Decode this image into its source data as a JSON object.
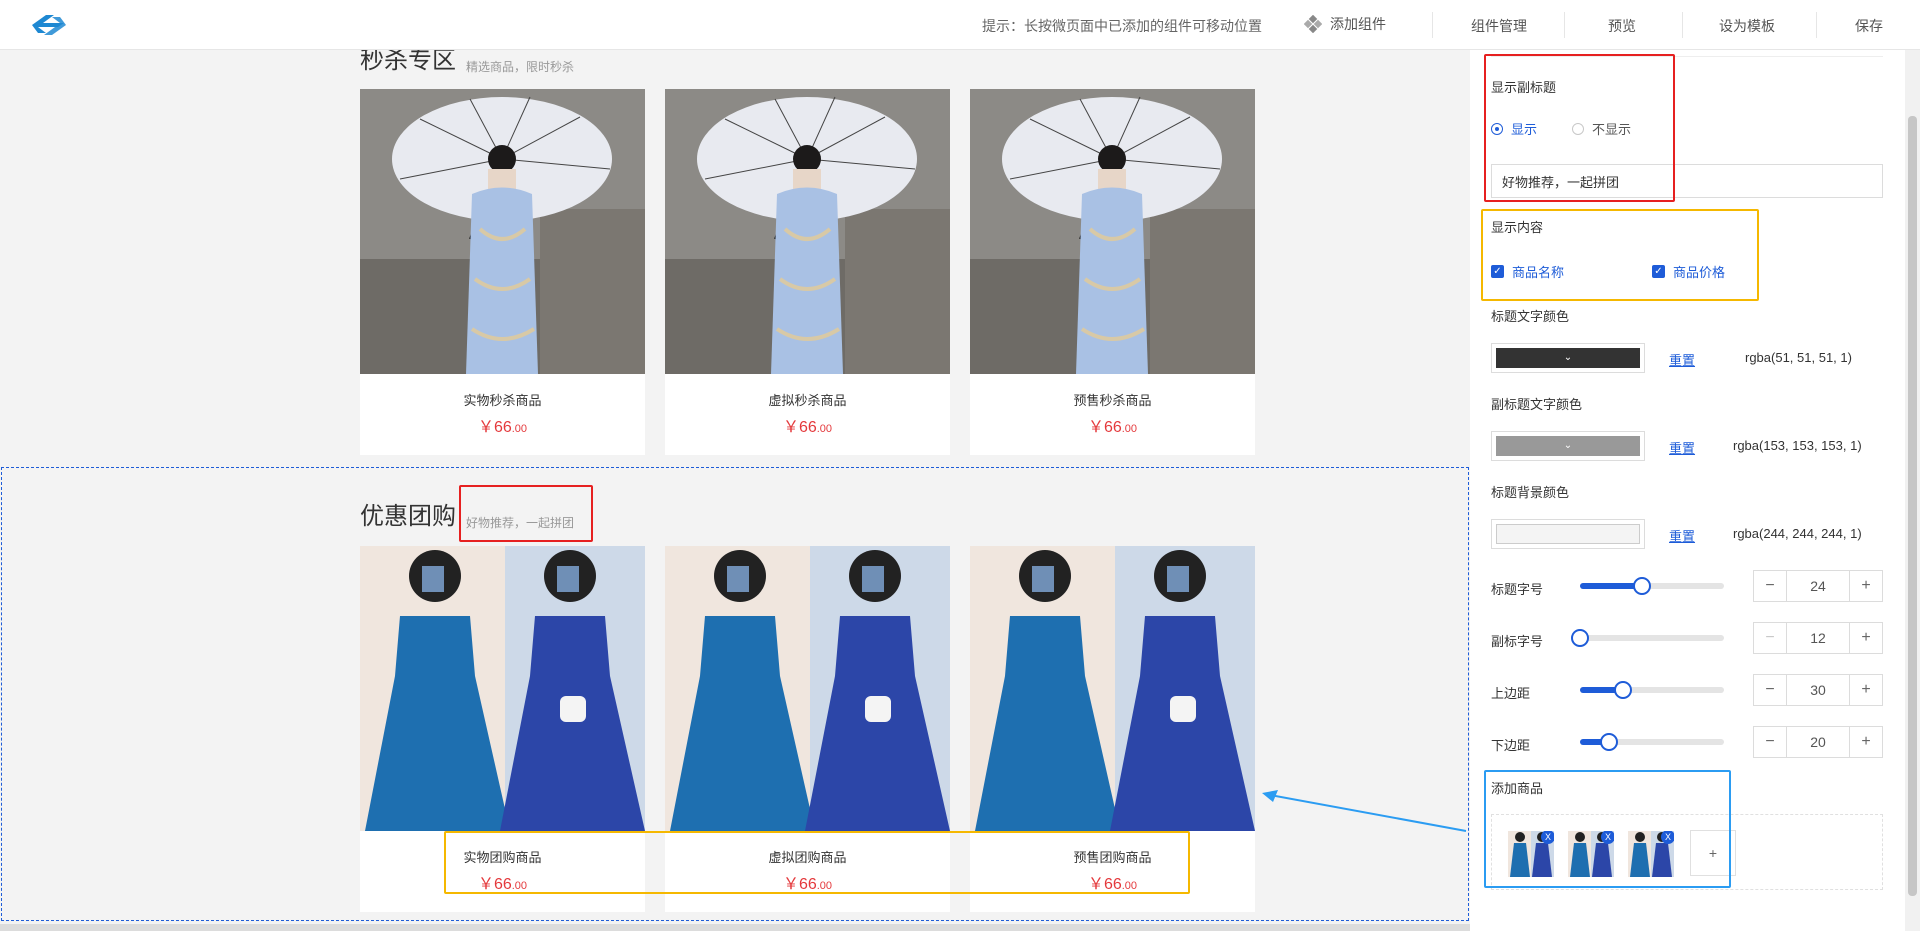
{
  "header": {
    "hint": "提示：长按微页面中已添加的组件可移动位置",
    "add_component": "添加组件",
    "nav": [
      "组件管理",
      "预览",
      "设为模板",
      "保存"
    ]
  },
  "sections": [
    {
      "title": "秒杀专区",
      "subtitle": "精选商品，限时秒杀",
      "products": [
        {
          "name": "实物秒杀商品",
          "price_symbol": "￥",
          "price_int": "66",
          "price_dec": ".00"
        },
        {
          "name": "虚拟秒杀商品",
          "price_symbol": "￥",
          "price_int": "66",
          "price_dec": ".00"
        },
        {
          "name": "预售秒杀商品",
          "price_symbol": "￥",
          "price_int": "66",
          "price_dec": ".00"
        }
      ]
    },
    {
      "title": "优惠团购",
      "subtitle": "好物推荐，一起拼团",
      "products": [
        {
          "name": "实物团购商品",
          "price_symbol": "￥",
          "price_int": "66",
          "price_dec": ".00"
        },
        {
          "name": "虚拟团购商品",
          "price_symbol": "￥",
          "price_int": "66",
          "price_dec": ".00"
        },
        {
          "name": "预售团购商品",
          "price_symbol": "￥",
          "price_int": "66",
          "price_dec": ".00"
        }
      ]
    }
  ],
  "panel": {
    "show_subtitle_label": "显示副标题",
    "radio_show": "显示",
    "radio_hide": "不显示",
    "subtitle_value": "好物推荐，一起拼团",
    "show_content_label": "显示内容",
    "check_name": "商品名称",
    "check_price": "商品价格",
    "check_mark": "✓",
    "title_color_label": "标题文字颜色",
    "subtitle_color_label": "副标题文字颜色",
    "title_bg_label": "标题背景颜色",
    "reset": "重置",
    "title_color": "rgba(51, 51, 51, 1)",
    "subtitle_color": "rgba(153, 153, 153, 1)",
    "title_bg": "rgba(244, 244, 244, 1)",
    "chevron": "⌄",
    "sliders": [
      {
        "label": "标题字号",
        "value": "24",
        "fraction": 0.43
      },
      {
        "label": "副标字号",
        "value": "12",
        "fraction": 0.0
      },
      {
        "label": "上边距",
        "value": "30",
        "fraction": 0.3
      },
      {
        "label": "下边距",
        "value": "20",
        "fraction": 0.2
      }
    ],
    "minus": "−",
    "plus": "+",
    "add_goods_label": "添加商品",
    "thumb_remove": "X",
    "thumb_add": "+"
  },
  "colors": {
    "accent": "#1e5cd8",
    "price": "#e4393c",
    "annotation_red": "#e62020",
    "annotation_orange": "#f5b800",
    "annotation_blue": "#2b9cf2"
  }
}
